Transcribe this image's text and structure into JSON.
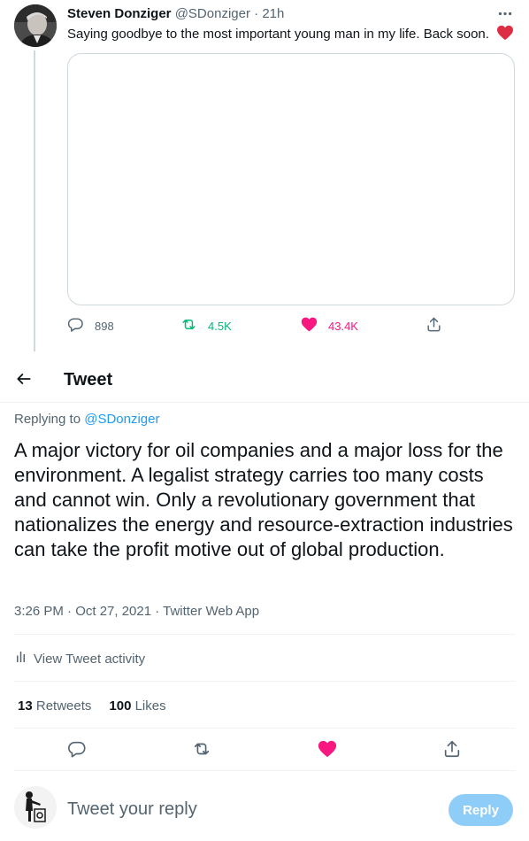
{
  "parent_tweet": {
    "author_name": "Steven Donziger",
    "author_handle": "@SDonziger",
    "separator": "·",
    "time_ago": "21h",
    "text": "Saying goodbye to the most important young man in my life. Back soon.",
    "emoji": "red-heart",
    "reply_count": "898",
    "retweet_count": "4.5K",
    "like_count": "43.4K"
  },
  "header": {
    "title": "Tweet"
  },
  "main_tweet": {
    "replying_to_label": "Replying to",
    "replying_to_handle": "@SDonziger",
    "text": "A major victory for oil companies and a major loss for the environment. A legalist strategy carries too many costs and cannot win. Only a revolutionary government that nationalizes the energy and resource-extraction industries can take the profit motive out of global production.",
    "timestamp": "3:26 PM · Oct 27, 2021 · Twitter Web App",
    "activity_label": "View Tweet activity",
    "retweets_count": "13",
    "retweets_label": "Retweets",
    "likes_count": "100",
    "likes_label": "Likes"
  },
  "composer": {
    "placeholder": "Tweet your reply",
    "reply_button": "Reply"
  },
  "colors": {
    "text": "#0f1419",
    "secondary": "#536471",
    "accent_blue": "#1d9bf0",
    "retweet_green": "#00ba7c",
    "like_pink": "#f91880",
    "reply_button_disabled": "#8ecdf8"
  }
}
